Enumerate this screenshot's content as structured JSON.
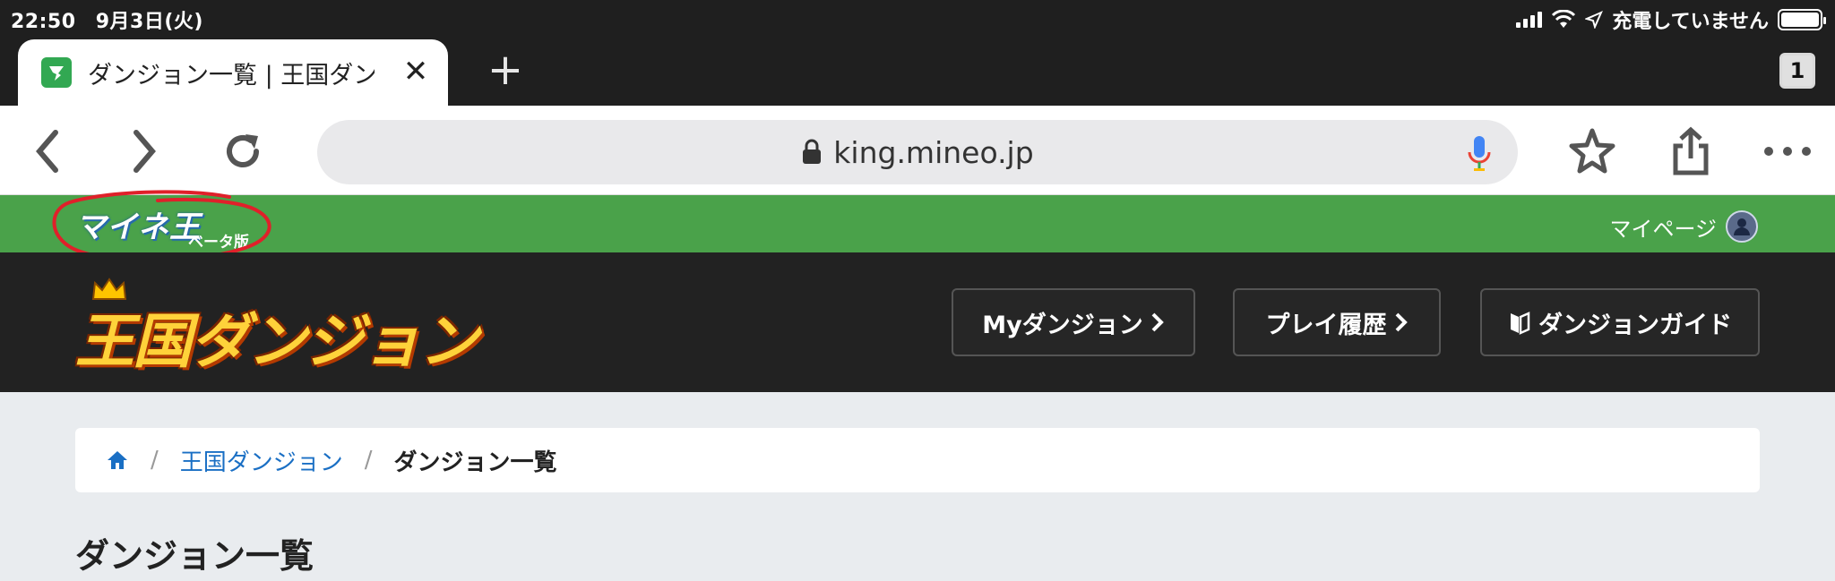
{
  "status": {
    "time": "22:50",
    "date": "9月3日(火)",
    "charging": "充電していません"
  },
  "tab": {
    "title": "ダンジョン一覧 | 王国ダン",
    "count": "1"
  },
  "toolbar": {
    "url": "king.mineo.jp"
  },
  "site": {
    "logo": "マイネ王",
    "beta": "ベータ版",
    "mypage": "マイページ",
    "brand": "王国ダンジョン",
    "nav": {
      "my_dungeon": "Myダンジョン",
      "play_history": "プレイ履歴",
      "guide": "ダンジョンガイド"
    }
  },
  "breadcrumb": {
    "home_icon": "home-icon",
    "item1": "王国ダンジョン",
    "separator": "/",
    "current": "ダンジョン一覧"
  },
  "page": {
    "title": "ダンジョン一覧"
  },
  "colors": {
    "site_green": "#4aa24a",
    "header_dark": "#222222",
    "link_blue": "#1a6fc4",
    "annotation_red": "#e0202a"
  }
}
